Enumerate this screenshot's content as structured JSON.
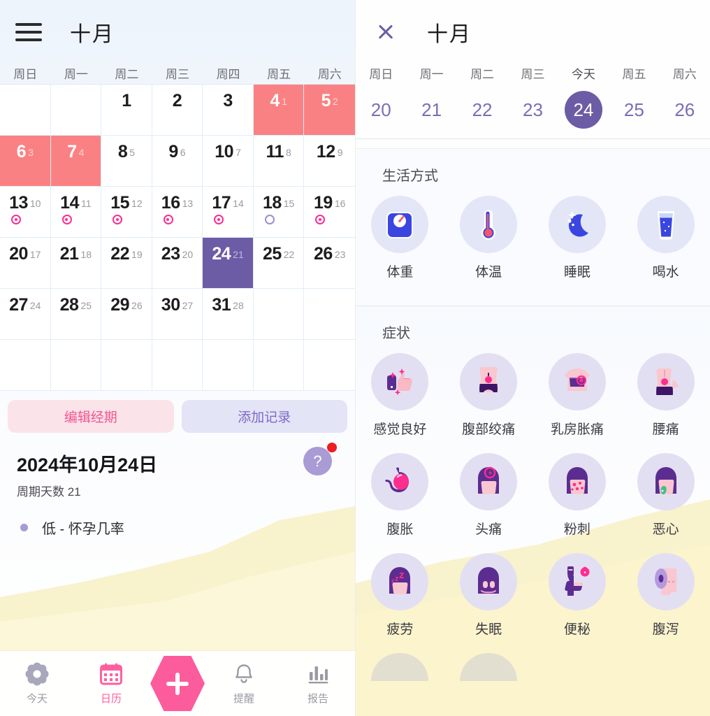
{
  "left": {
    "header": {
      "menu_icon": "hamburger-menu-icon",
      "month": "十月"
    },
    "weekdays": [
      "周日",
      "周一",
      "周二",
      "周三",
      "周四",
      "周五",
      "周六"
    ],
    "calendar": {
      "leading_blanks": 2,
      "days": [
        {
          "d": "1",
          "c": "",
          "state": "normal",
          "marker": ""
        },
        {
          "d": "2",
          "c": "",
          "state": "normal",
          "marker": ""
        },
        {
          "d": "3",
          "c": "",
          "state": "normal",
          "marker": ""
        },
        {
          "d": "4",
          "c": "1",
          "state": "period",
          "marker": ""
        },
        {
          "d": "5",
          "c": "2",
          "state": "period",
          "marker": ""
        },
        {
          "d": "6",
          "c": "3",
          "state": "period",
          "marker": ""
        },
        {
          "d": "7",
          "c": "4",
          "state": "period",
          "marker": ""
        },
        {
          "d": "8",
          "c": "5",
          "state": "normal",
          "marker": ""
        },
        {
          "d": "9",
          "c": "6",
          "state": "normal",
          "marker": ""
        },
        {
          "d": "10",
          "c": "7",
          "state": "normal",
          "marker": ""
        },
        {
          "d": "11",
          "c": "8",
          "state": "normal",
          "marker": ""
        },
        {
          "d": "12",
          "c": "9",
          "state": "normal",
          "marker": ""
        },
        {
          "d": "13",
          "c": "10",
          "state": "normal",
          "marker": "fertile"
        },
        {
          "d": "14",
          "c": "11",
          "state": "normal",
          "marker": "fertile"
        },
        {
          "d": "15",
          "c": "12",
          "state": "normal",
          "marker": "fertile"
        },
        {
          "d": "16",
          "c": "13",
          "state": "normal",
          "marker": "fertile"
        },
        {
          "d": "17",
          "c": "14",
          "state": "normal",
          "marker": "fertile"
        },
        {
          "d": "18",
          "c": "15",
          "state": "normal",
          "marker": "ovu"
        },
        {
          "d": "19",
          "c": "16",
          "state": "normal",
          "marker": "fertile"
        },
        {
          "d": "20",
          "c": "17",
          "state": "normal",
          "marker": ""
        },
        {
          "d": "21",
          "c": "18",
          "state": "normal",
          "marker": ""
        },
        {
          "d": "22",
          "c": "19",
          "state": "normal",
          "marker": ""
        },
        {
          "d": "23",
          "c": "20",
          "state": "normal",
          "marker": ""
        },
        {
          "d": "24",
          "c": "21",
          "state": "selected",
          "marker": ""
        },
        {
          "d": "25",
          "c": "22",
          "state": "normal",
          "marker": ""
        },
        {
          "d": "26",
          "c": "23",
          "state": "normal",
          "marker": ""
        },
        {
          "d": "27",
          "c": "24",
          "state": "normal",
          "marker": ""
        },
        {
          "d": "28",
          "c": "25",
          "state": "normal",
          "marker": ""
        },
        {
          "d": "29",
          "c": "26",
          "state": "normal",
          "marker": ""
        },
        {
          "d": "30",
          "c": "27",
          "state": "normal",
          "marker": ""
        },
        {
          "d": "31",
          "c": "28",
          "state": "normal",
          "marker": ""
        }
      ]
    },
    "actions": {
      "edit_period": "编辑经期",
      "add_record": "添加记录"
    },
    "info": {
      "date": "2024年10月24日",
      "cycle_day": "周期天数 21",
      "pregnancy_probability": "低 - 怀孕几率",
      "help_label": "?"
    },
    "tabbar": [
      {
        "label": "今天",
        "icon": "flower-icon",
        "active": false
      },
      {
        "label": "日历",
        "icon": "calendar-icon",
        "active": true
      },
      {
        "label": "",
        "icon": "plus-icon",
        "active": false
      },
      {
        "label": "提醒",
        "icon": "bell-icon",
        "active": false
      },
      {
        "label": "报告",
        "icon": "bar-chart-icon",
        "active": false
      }
    ]
  },
  "right": {
    "header": {
      "close_icon": "close-icon",
      "month": "十月"
    },
    "weekstrip": [
      {
        "label": "周日",
        "day": "20",
        "today": false
      },
      {
        "label": "周一",
        "day": "21",
        "today": false
      },
      {
        "label": "周二",
        "day": "22",
        "today": false
      },
      {
        "label": "周三",
        "day": "23",
        "today": false
      },
      {
        "label": "今天",
        "day": "24",
        "today": true
      },
      {
        "label": "周五",
        "day": "25",
        "today": false
      },
      {
        "label": "周六",
        "day": "26",
        "today": false
      }
    ],
    "lifestyle": {
      "title": "生活方式",
      "items": [
        {
          "label": "体重",
          "icon": "weight-scale-icon"
        },
        {
          "label": "体温",
          "icon": "thermometer-icon"
        },
        {
          "label": "睡眠",
          "icon": "moon-sleep-icon"
        },
        {
          "label": "喝水",
          "icon": "water-glass-icon"
        }
      ]
    },
    "symptoms": {
      "title": "症状",
      "items": [
        {
          "label": "感觉良好",
          "icon": "thumbs-up-icon"
        },
        {
          "label": "腹部绞痛",
          "icon": "abdominal-cramps-icon"
        },
        {
          "label": "乳房胀痛",
          "icon": "breast-tenderness-icon"
        },
        {
          "label": "腰痛",
          "icon": "back-pain-icon"
        },
        {
          "label": "腹胀",
          "icon": "bloating-stomach-icon"
        },
        {
          "label": "头痛",
          "icon": "headache-icon"
        },
        {
          "label": "粉刺",
          "icon": "acne-icon"
        },
        {
          "label": "恶心",
          "icon": "nausea-icon"
        },
        {
          "label": "疲劳",
          "icon": "fatigue-zzz-icon"
        },
        {
          "label": "失眠",
          "icon": "insomnia-icon"
        },
        {
          "label": "便秘",
          "icon": "constipation-toilet-icon"
        },
        {
          "label": "腹泻",
          "icon": "diarrhea-tissue-icon"
        }
      ]
    }
  },
  "colors": {
    "period": "#fa8183",
    "selected": "#6c5ca5",
    "accent_pink": "#ff5f9e",
    "fertile_dot": "#ff2d8f",
    "ovulation_dot": "#9b8ed4",
    "badge_red": "#ee1c23"
  }
}
